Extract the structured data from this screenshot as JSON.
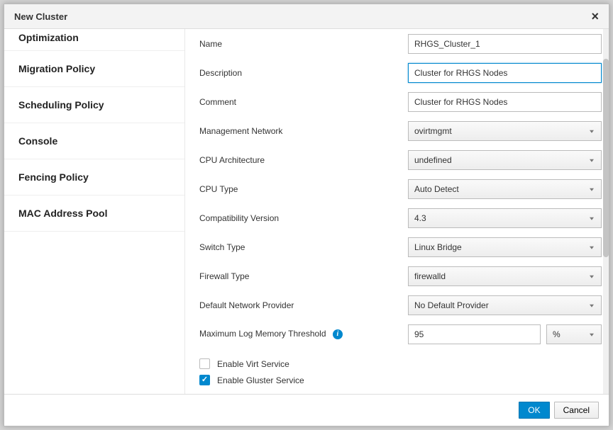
{
  "modal": {
    "title": "New Cluster",
    "close_icon": "×"
  },
  "sidebar": {
    "items": [
      {
        "label": "Optimization"
      },
      {
        "label": "Migration Policy"
      },
      {
        "label": "Scheduling Policy"
      },
      {
        "label": "Console"
      },
      {
        "label": "Fencing Policy"
      },
      {
        "label": "MAC Address Pool"
      }
    ]
  },
  "form": {
    "name": {
      "label": "Name",
      "value": "RHGS_Cluster_1"
    },
    "description": {
      "label": "Description",
      "value": "Cluster for RHGS Nodes"
    },
    "comment": {
      "label": "Comment",
      "value": "Cluster for RHGS Nodes"
    },
    "management_network": {
      "label": "Management Network",
      "value": "ovirtmgmt"
    },
    "cpu_architecture": {
      "label": "CPU Architecture",
      "value": "undefined"
    },
    "cpu_type": {
      "label": "CPU Type",
      "value": "Auto Detect"
    },
    "compatibility_version": {
      "label": "Compatibility Version",
      "value": "4.3"
    },
    "switch_type": {
      "label": "Switch Type",
      "value": "Linux Bridge"
    },
    "firewall_type": {
      "label": "Firewall Type",
      "value": "firewalld"
    },
    "default_network_provider": {
      "label": "Default Network Provider",
      "value": "No Default Provider"
    },
    "max_log_memory": {
      "label": "Maximum Log Memory Threshold",
      "value": "95",
      "unit": "%"
    },
    "enable_virt": {
      "label": "Enable Virt Service",
      "checked": false
    },
    "enable_gluster": {
      "label": "Enable Gluster Service",
      "checked": true
    }
  },
  "footer": {
    "ok": "OK",
    "cancel": "Cancel"
  }
}
